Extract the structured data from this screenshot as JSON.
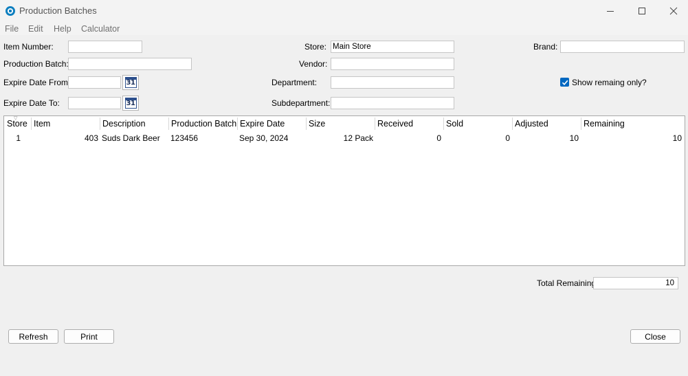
{
  "window": {
    "title": "Production Batches"
  },
  "menu": [
    "File",
    "Edit",
    "Help",
    "Calculator"
  ],
  "form": {
    "item_number_label": "Item Number:",
    "item_number_value": "",
    "production_batch_label": "Production Batch:",
    "production_batch_value": "",
    "expire_from_label": "Expire Date From:",
    "expire_from_value": "",
    "expire_to_label": "Expire Date To:",
    "expire_to_value": "",
    "calendar_glyph": "31",
    "store_label": "Store:",
    "store_value": "Main Store",
    "vendor_label": "Vendor:",
    "vendor_value": "",
    "department_label": "Department:",
    "department_value": "",
    "subdepartment_label": "Subdepartment:",
    "subdepartment_value": "",
    "brand_label": "Brand:",
    "brand_value": "",
    "show_remaining_label": "Show remaing only?",
    "show_remaining_checked": true
  },
  "grid": {
    "columns": [
      "Store",
      "Item",
      "Description",
      "Production Batch",
      "Expire Date",
      "Size",
      "Received",
      "Sold",
      "Adjusted",
      "Remaining"
    ],
    "rows": [
      {
        "store": "1",
        "item": "403",
        "description": "Suds Dark Beer",
        "production_batch": "123456",
        "expire_date": "Sep 30, 2024",
        "size": "12 Pack",
        "received": "0",
        "sold": "0",
        "adjusted": "10",
        "remaining": "10"
      }
    ]
  },
  "totals": {
    "label": "Total Remaining:",
    "value": "10"
  },
  "buttons": {
    "refresh": "Refresh",
    "print": "Print",
    "close": "Close"
  },
  "colors": {
    "checkbox_accent": "#0067c0",
    "calendar_accent": "#2c4f8c"
  }
}
